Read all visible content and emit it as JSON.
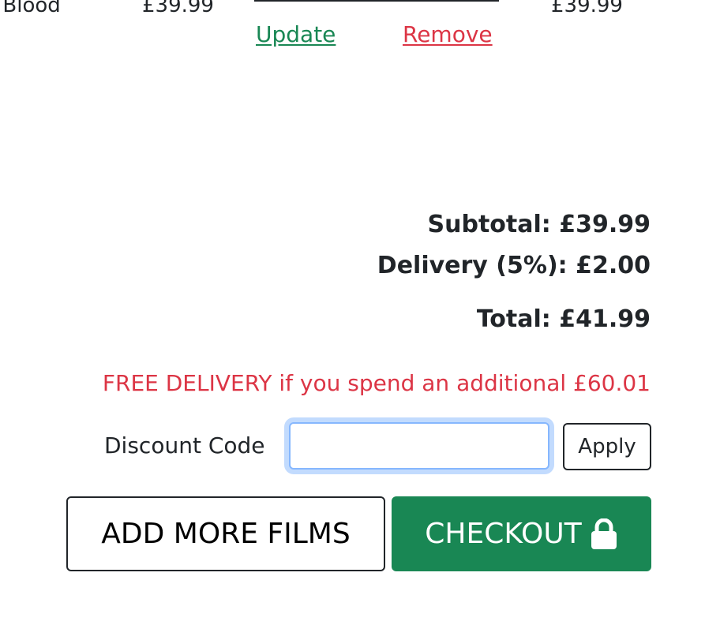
{
  "cart_item": {
    "title": "f Blood",
    "price": "£39.99",
    "subtotal": "£39.99",
    "update_label": "Update",
    "remove_label": "Remove"
  },
  "summary": {
    "subtotal": "Subtotal: £39.99",
    "delivery": "Delivery (5%): £2.00",
    "total": "Total: £41.99",
    "free_delivery_notice": "FREE DELIVERY if you spend an additional £60.01"
  },
  "discount": {
    "label": "Discount Code",
    "value": "",
    "placeholder": "",
    "apply_label": "Apply"
  },
  "actions": {
    "add_more_label": "ADD MORE FILMS",
    "checkout_label": "CHECKOUT",
    "checkout_icon": "lock-icon"
  },
  "colors": {
    "success": "#198754",
    "danger": "#dc3545",
    "text": "#212529",
    "focus": "#86b7fe"
  }
}
